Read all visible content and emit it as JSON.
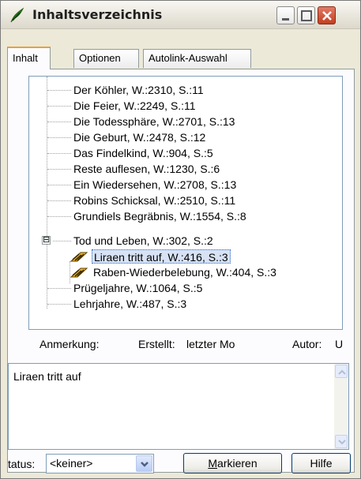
{
  "window": {
    "title": "Inhaltsverzeichnis",
    "icon": "quill-icon"
  },
  "titlebar_buttons": [
    "minimize",
    "maximize",
    "close"
  ],
  "tabs": [
    {
      "label": "Inhalt"
    },
    {
      "label": "Optionen"
    },
    {
      "label": "Autolink-Auswahl"
    }
  ],
  "tree": {
    "items": [
      {
        "label": "Der Köhler, W.:2310, S.:11"
      },
      {
        "label": "Die Feier, W.:2249, S.:11"
      },
      {
        "label": "Die Todessphäre, W.:2701, S.:13"
      },
      {
        "label": "Die Geburt, W.:2478, S.:12"
      },
      {
        "label": "Das Findelkind, W.:904, S.:5"
      },
      {
        "label": "Reste auflesen, W.:1230, S.:6"
      },
      {
        "label": "Ein Wiedersehen, W.:2708, S.:13"
      },
      {
        "label": "Robins Schicksal, W.:2510, S.:11"
      },
      {
        "label": "Grundiels Begräbnis, W.:1554, S.:8"
      },
      {
        "label": "Tod und Leben, W.:302, S.:2"
      },
      {
        "label": "Liraen tritt auf, W.:416, S.:3"
      },
      {
        "label": "Raben-Wiederbelebung, W.:404, S.:3"
      },
      {
        "label": "Prügeljahre, W.:1064, S.:5"
      },
      {
        "label": "Lehrjahre, W.:487, S.:3"
      }
    ],
    "expander_symbol": "⊟"
  },
  "meta": {
    "annotation_label": "Anmerkung:",
    "created_label": "Erstellt:",
    "created_value": "letzter Mo",
    "author_label": "Autor:",
    "author_value": "U"
  },
  "memo": {
    "text": "Liraen tritt auf"
  },
  "footer": {
    "status_label": "tatus:",
    "status_value": "<keiner>",
    "mark_button": "Markieren",
    "help_button": "Hilfe"
  },
  "colors": {
    "window_bg": "#ece9d8",
    "close_button": "#c23d21",
    "selection_border": "#316ac5",
    "active_tab_accent": "#e8a13b"
  }
}
